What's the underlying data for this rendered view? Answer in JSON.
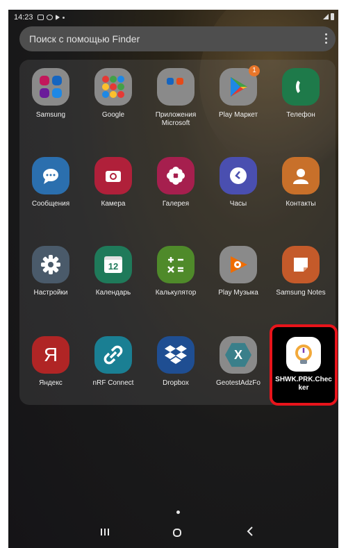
{
  "status": {
    "time": "14:23"
  },
  "search": {
    "placeholder": "Поиск с помощью Finder"
  },
  "apps": [
    {
      "id": "samsung",
      "label": "Samsung",
      "icon": "folder-icon",
      "color": "#8a8a8a"
    },
    {
      "id": "google",
      "label": "Google",
      "icon": "folder-icon",
      "color": "#8a8a8a"
    },
    {
      "id": "microsoft",
      "label": "Приложения Microsoft",
      "icon": "folder-icon",
      "color": "#8a8a8a"
    },
    {
      "id": "play-market",
      "label": "Play Маркет",
      "icon": "play-store-icon",
      "color": "#8a8a8a",
      "badge": "1"
    },
    {
      "id": "phone",
      "label": "Телефон",
      "icon": "phone-icon",
      "color": "#1e7a4a"
    },
    {
      "id": "messages",
      "label": "Сообщения",
      "icon": "message-icon",
      "color": "#2b6fae"
    },
    {
      "id": "camera",
      "label": "Камера",
      "icon": "camera-icon",
      "color": "#b0203a"
    },
    {
      "id": "gallery",
      "label": "Галерея",
      "icon": "flower-icon",
      "color": "#a61f4e"
    },
    {
      "id": "clock",
      "label": "Часы",
      "icon": "clock-icon",
      "color": "#4a4fb0"
    },
    {
      "id": "contacts",
      "label": "Контакты",
      "icon": "contact-icon",
      "color": "#c8702a"
    },
    {
      "id": "settings",
      "label": "Настройки",
      "icon": "gear-icon",
      "color": "#4a5a6a"
    },
    {
      "id": "calendar",
      "label": "Календарь",
      "icon": "calendar-icon",
      "color": "#1f7a5a",
      "number": "12"
    },
    {
      "id": "calculator",
      "label": "Калькулятор",
      "icon": "calculator-icon",
      "color": "#4f8a2a"
    },
    {
      "id": "play-music",
      "label": "Play Музыка",
      "icon": "music-icon",
      "color": "#8a8a8a"
    },
    {
      "id": "samsung-notes",
      "label": "Samsung Notes",
      "icon": "notes-icon",
      "color": "#c45a2a"
    },
    {
      "id": "yandex",
      "label": "Яндекс",
      "icon": "yandex-icon",
      "color": "#b02525",
      "glyph": "Я"
    },
    {
      "id": "nrf-connect",
      "label": "nRF Connect",
      "icon": "link-icon",
      "color": "#1a7f93"
    },
    {
      "id": "dropbox",
      "label": "Dropbox",
      "icon": "dropbox-icon",
      "color": "#1f4e92"
    },
    {
      "id": "geotest",
      "label": "GeotestAdzFo",
      "icon": "geotest-icon",
      "color": "#3a7f8a",
      "glyph": "X"
    }
  ],
  "highlighted_app": {
    "label": "SHWK.PRK.Checker",
    "icon": "gauge-icon"
  }
}
